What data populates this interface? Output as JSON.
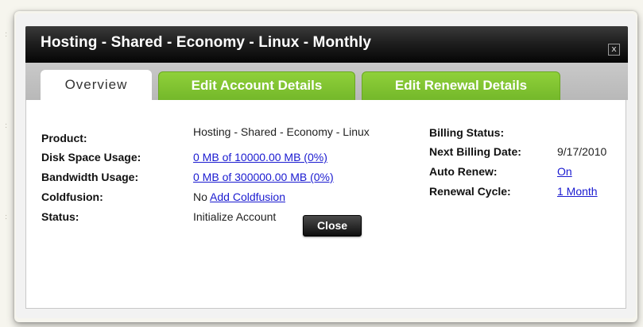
{
  "dialog": {
    "title": "Hosting - Shared - Economy - Linux - Monthly",
    "close_x": "x"
  },
  "tabs": [
    {
      "label": "Overview",
      "active": true
    },
    {
      "label": "Edit Account Details",
      "active": false
    },
    {
      "label": "Edit Renewal Details",
      "active": false
    }
  ],
  "details": {
    "product_label": "Product:",
    "product_value": "Hosting - Shared - Economy - Linux",
    "disk_label": "Disk Space Usage:",
    "disk_value": "0 MB of 10000.00 MB (0%)",
    "bandwidth_label": "Bandwidth Usage:",
    "bandwidth_value": "0 MB of 300000.00 MB (0%)",
    "coldfusion_label": "Coldfusion:",
    "coldfusion_value": "No",
    "coldfusion_link": "Add Coldfusion",
    "status_label": "Status:",
    "status_value": "Initialize Account"
  },
  "billing": {
    "status_label": "Billing Status:",
    "status_value": "",
    "next_date_label": "Next Billing Date:",
    "next_date_value": "9/17/2010",
    "auto_renew_label": "Auto Renew:",
    "auto_renew_value": "On",
    "cycle_label": "Renewal Cycle:",
    "cycle_value": "1 Month"
  },
  "buttons": {
    "close_label": "Close"
  },
  "colors": {
    "tab_green": "#7bc02e",
    "link_blue": "#1a1ad0",
    "titlebar": "#1f1f1f"
  }
}
